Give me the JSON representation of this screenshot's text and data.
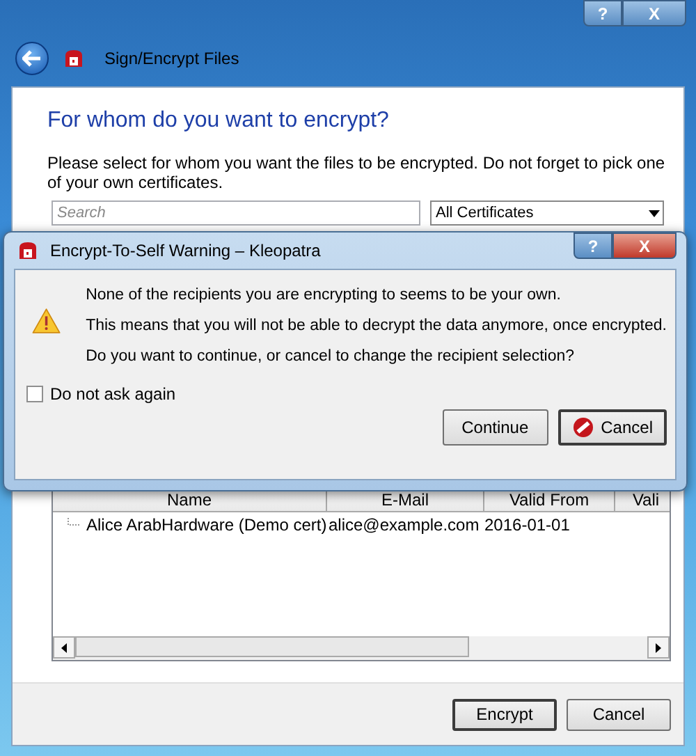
{
  "window": {
    "title": "Sign/Encrypt Files",
    "help": "?",
    "close": "X"
  },
  "page": {
    "heading": "For whom do you want to encrypt?",
    "description": "Please select for whom you want the files to be encrypted. Do not forget to pick one of your own certificates.",
    "search": {
      "placeholder": "Search"
    },
    "filter": {
      "value": "All Certificates"
    }
  },
  "table": {
    "columns": [
      "Name",
      "E-Mail",
      "Valid From",
      "Vali"
    ],
    "rows": [
      {
        "cells": [
          "Alice ArabHardware (Demo cert)",
          "alice@example.com",
          "2016-01-01"
        ]
      }
    ]
  },
  "buttons": [
    {
      "label": "Encrypt",
      "default": true
    },
    {
      "label": "Cancel",
      "default": false
    }
  ],
  "dialog": {
    "title": "Encrypt-To-Self Warning – Kleopatra",
    "help": "?",
    "close": "X",
    "messages": [
      "None of the recipients you are encrypting to seems to be your own.",
      "This means that you will not be able to decrypt the data anymore, once encrypted.",
      "Do you want to continue, or cancel to change the recipient selection?"
    ],
    "checkbox": {
      "label": "Do not ask again",
      "checked": false
    },
    "buttons": [
      {
        "label": "Continue",
        "kind": "plain",
        "default": false
      },
      {
        "label": "Cancel",
        "kind": "cancel",
        "default": true
      }
    ]
  }
}
